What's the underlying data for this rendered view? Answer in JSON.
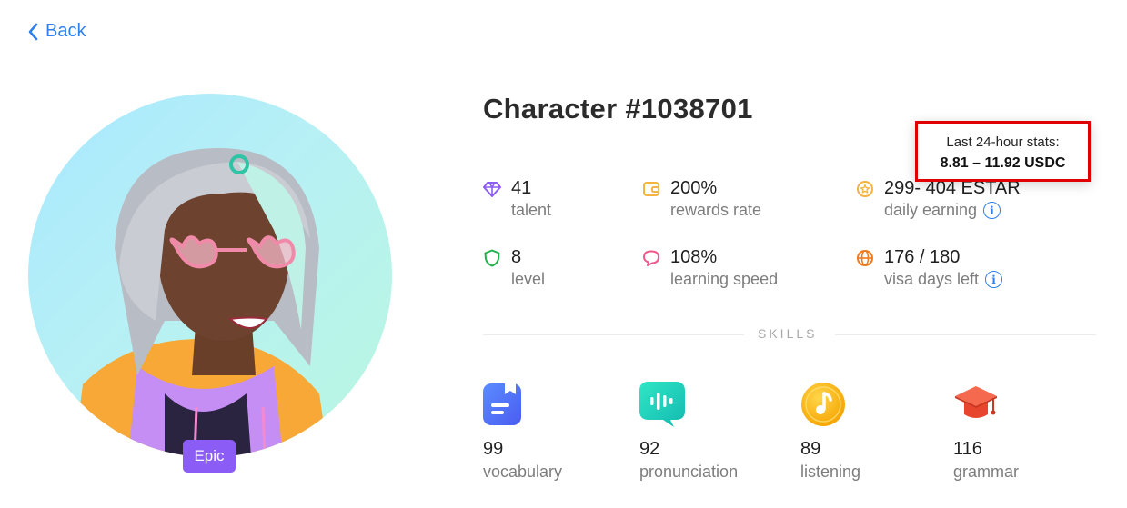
{
  "nav": {
    "back_label": "Back"
  },
  "character": {
    "title": "Character #1038701",
    "rarity": "Epic",
    "colors": {
      "accent": "#2f7ff0",
      "rarity_badge": "#8b5cf6",
      "highlight_box": "#e00000"
    }
  },
  "stats": [
    {
      "icon": "diamond-icon",
      "value": "41",
      "label": "talent",
      "color": "#8b5cf6"
    },
    {
      "icon": "wallet-icon",
      "value": "200%",
      "label": "rewards rate",
      "color": "#f5b342"
    },
    {
      "icon": "coin-star-icon",
      "value": "299- 404 ESTAR",
      "label": "daily earning",
      "color": "#f5b342"
    },
    {
      "icon": "shield-icon",
      "value": "8",
      "label": "level",
      "color": "#22b14c"
    },
    {
      "icon": "speech-bubble-icon",
      "value": "108%",
      "label": "learning speed",
      "color": "#f0568c"
    },
    {
      "icon": "globe-icon",
      "value": "176 / 180",
      "label": "visa days left",
      "color": "#f07a1c"
    }
  ],
  "tooltip": {
    "title": "Last 24-hour stats:",
    "value": "8.81 – 11.92 USDC"
  },
  "skills_section": {
    "title": "SKILLS",
    "items": [
      {
        "icon": "vocabulary-book-icon",
        "value": "99",
        "label": "vocabulary"
      },
      {
        "icon": "sound-wave-chat-icon",
        "value": "92",
        "label": "pronunciation"
      },
      {
        "icon": "music-note-icon",
        "value": "89",
        "label": "listening"
      },
      {
        "icon": "graduation-cap-icon",
        "value": "116",
        "label": "grammar"
      }
    ]
  }
}
